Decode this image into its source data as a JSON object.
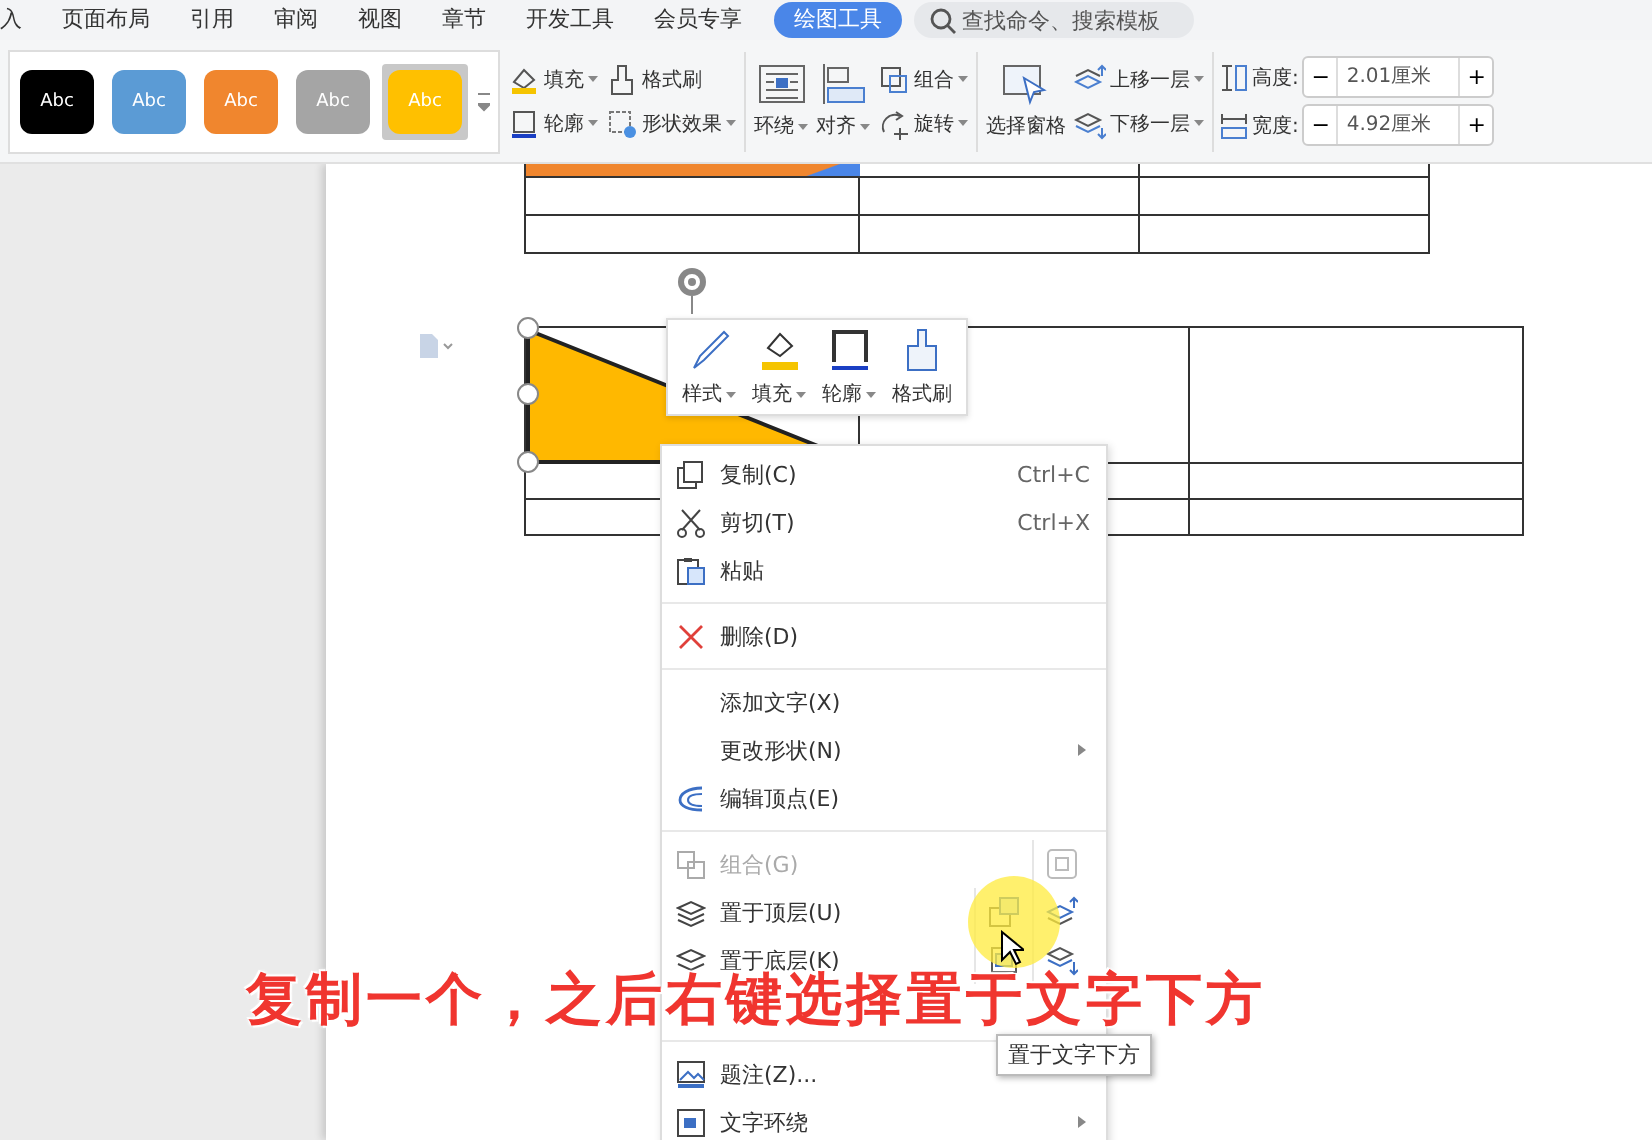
{
  "menu_tabs": [
    {
      "label": "入",
      "selected": false
    },
    {
      "label": "页面布局",
      "selected": false
    },
    {
      "label": "引用",
      "selected": false
    },
    {
      "label": "审阅",
      "selected": false
    },
    {
      "label": "视图",
      "selected": false
    },
    {
      "label": "章节",
      "selected": false
    },
    {
      "label": "开发工具",
      "selected": false
    },
    {
      "label": "会员专享",
      "selected": false
    },
    {
      "label": "绘图工具",
      "selected": true
    }
  ],
  "search": {
    "placeholder": "查找命令、搜索模板"
  },
  "ribbon": {
    "styles": [
      {
        "label": "Abc",
        "color": "#000000",
        "selected": false
      },
      {
        "label": "Abc",
        "color": "#5b9bd5",
        "selected": false
      },
      {
        "label": "Abc",
        "color": "#f0862e",
        "selected": false
      },
      {
        "label": "Abc",
        "color": "#a5a5a5",
        "selected": false
      },
      {
        "label": "Abc",
        "color": "#ffc000",
        "selected": true
      }
    ],
    "columns": [
      {
        "buttons": [
          {
            "label": "填充",
            "kind": "small",
            "dropdown": true
          },
          {
            "label": "轮廓",
            "kind": "small",
            "dropdown": true
          }
        ]
      },
      {
        "buttons": [
          {
            "label": "格式刷",
            "kind": "small",
            "dropdown": false
          },
          {
            "label": "形状效果",
            "kind": "small",
            "dropdown": true
          }
        ]
      },
      {
        "buttons": [
          {
            "label": "环绕",
            "kind": "large",
            "dropdown": true
          }
        ]
      },
      {
        "buttons": [
          {
            "label": "对齐",
            "kind": "large",
            "dropdown": true
          }
        ]
      },
      {
        "buttons": [
          {
            "label": "组合",
            "kind": "small",
            "dropdown": true
          },
          {
            "label": "旋转",
            "kind": "small",
            "dropdown": true
          }
        ]
      },
      {
        "buttons": [
          {
            "label": "选择窗格",
            "kind": "large",
            "dropdown": false
          }
        ]
      },
      {
        "buttons": [
          {
            "label": "上移一层",
            "kind": "small",
            "dropdown": true
          },
          {
            "label": "下移一层",
            "kind": "small",
            "dropdown": true
          }
        ]
      }
    ],
    "size_fields": [
      {
        "label": "高度:",
        "value": "2.01厘米",
        "minus": "−",
        "plus": "+"
      },
      {
        "label": "宽度:",
        "value": "4.92厘米",
        "minus": "−",
        "plus": "+"
      }
    ]
  },
  "mini_toolbar": [
    {
      "label": "样式",
      "dropdown": true
    },
    {
      "label": "填充",
      "dropdown": true
    },
    {
      "label": "轮廓",
      "dropdown": true
    },
    {
      "label": "格式刷",
      "dropdown": false
    }
  ],
  "context_menu": [
    {
      "kind": "item",
      "label": "复制(C)",
      "shortcut": "Ctrl+C",
      "disabled": false,
      "submenu": false
    },
    {
      "kind": "item",
      "label": "剪切(T)",
      "shortcut": "Ctrl+X",
      "disabled": false,
      "submenu": false
    },
    {
      "kind": "item",
      "label": "粘贴",
      "disabled": false,
      "submenu": false
    },
    {
      "kind": "separator"
    },
    {
      "kind": "item",
      "label": "删除(D)",
      "disabled": false,
      "submenu": false
    },
    {
      "kind": "separator"
    },
    {
      "kind": "item",
      "label": "添加文字(X)",
      "disabled": false,
      "submenu": false
    },
    {
      "kind": "item",
      "label": "更改形状(N)",
      "disabled": false,
      "submenu": true
    },
    {
      "kind": "item",
      "label": "编辑顶点(E)",
      "disabled": false,
      "submenu": false
    },
    {
      "kind": "separator"
    },
    {
      "kind": "split",
      "label": "组合(G)",
      "disabled": true,
      "submenu": false
    },
    {
      "kind": "split",
      "label": "置于顶层(U)",
      "disabled": false,
      "submenu": false
    },
    {
      "kind": "split",
      "label": "置于底层(K)",
      "disabled": false,
      "submenu": false
    },
    {
      "kind": "covered"
    },
    {
      "kind": "separator"
    },
    {
      "kind": "item",
      "label": "题注(Z)...",
      "disabled": false,
      "submenu": false
    },
    {
      "kind": "item",
      "label": "文字环绕",
      "disabled": false,
      "submenu": true
    }
  ],
  "tooltip": "置于文字下方",
  "caption": "复制一个，之后右键选择置于文字下方"
}
